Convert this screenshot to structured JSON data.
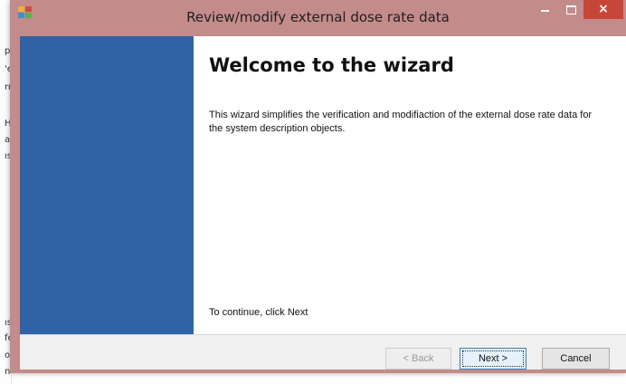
{
  "background_app": {
    "glyphs": [
      "p",
      "'e",
      "rr",
      "H",
      "a",
      "ıs",
      "ıs",
      "fe",
      "o",
      "n"
    ]
  },
  "window": {
    "title": "Review/modify external dose rate data",
    "app_icon": "app-icon",
    "controls": {
      "minimize_icon": "minimize-icon",
      "maximize_icon": "maximize-icon",
      "close_glyph": "×"
    },
    "colors": {
      "frame": "#c48b8b",
      "close": "#c7463a",
      "side_panel": "#3063a6"
    }
  },
  "wizard": {
    "heading": "Welcome to the wizard",
    "description": "This wizard simplifies the verification and modifiaction of the external dose rate data for the system description objects.",
    "continue_text": "To continue, click Next",
    "buttons": {
      "back": "< Back",
      "next": "Next >",
      "cancel": "Cancel"
    }
  }
}
